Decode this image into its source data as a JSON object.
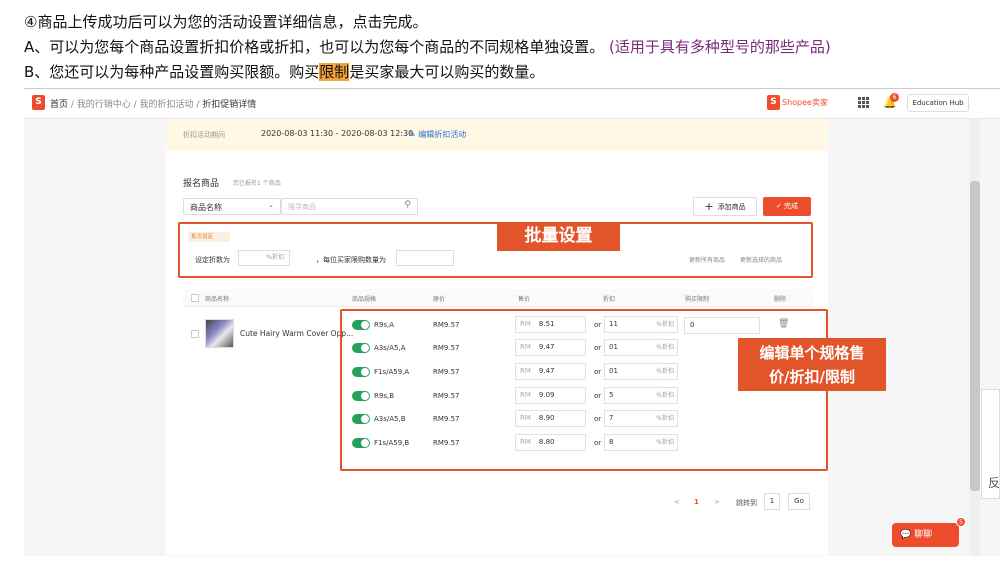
{
  "instructions": {
    "line1": "④商品上传成功后可以为您的活动设置详细信息，点击完成。",
    "line2": "A、可以为您每个商品设置折扣价格或折扣，也可以为您每个商品的不同规格单独设置。",
    "line2_note": "(适用于具有多种型号的那些产品)",
    "line3_a": "B、您还可以为每种产品设置购买限额。购买",
    "line3_hl": "限制",
    "line3_b": "是买家最大可以购买的数量。"
  },
  "header": {
    "logo_letter": "S",
    "breadcrumb_home": "首页",
    "breadcrumb_rest": " / 我的行销中心 / 我的折扣活动 / ",
    "breadcrumb_current": "折扣促销详情",
    "brand": "Shopee卖家",
    "notif_count": "6",
    "edu_hub": "Education Hub"
  },
  "period": {
    "label": "折扣活动期间",
    "value": "2020-08-03 11:30 - 2020-08-03 12:30",
    "edit": "编辑折扣活动"
  },
  "products": {
    "title": "报名商品",
    "subtitle": "您已报名1 个商品",
    "filter_select": "商品名称",
    "search_placeholder": "搜寻商品",
    "add_button": "添加商品",
    "done_button": "完成"
  },
  "batch": {
    "tag": "批次设定",
    "discount_label": "设定折数为",
    "discount_suffix": "%折扣",
    "limit_label": "，每位买家限购数量为",
    "update_all": "更新所有商品",
    "update_selected": "更新选择的商品",
    "callout": "批量设置"
  },
  "table": {
    "headers": [
      "商品名称",
      "商品规格",
      "原价",
      "售价",
      "折扣",
      "购买限制",
      "删除"
    ],
    "product_name": "Cute Hairy Warm Cover Opp...",
    "limit_value": "0",
    "currency": "RM",
    "or_label": "or",
    "pct_label": "%折扣",
    "rows": [
      {
        "spec": "R9s,A",
        "orig": "RM9.57",
        "price": "8.51",
        "discount": "11"
      },
      {
        "spec": "A3s/A5,A",
        "orig": "RM9.57",
        "price": "9.47",
        "discount": "01"
      },
      {
        "spec": "F1s/A59,A",
        "orig": "RM9.57",
        "price": "9.47",
        "discount": "01"
      },
      {
        "spec": "R9s,B",
        "orig": "RM9.57",
        "price": "9.09",
        "discount": "5"
      },
      {
        "spec": "A3s/A5,B",
        "orig": "RM9.57",
        "price": "8.90",
        "discount": "7"
      },
      {
        "spec": "F1s/A59,B",
        "orig": "RM9.57",
        "price": "8.80",
        "discount": "8"
      }
    ],
    "callout_line1": "编辑单个规格售",
    "callout_line2": "价/折扣/限制"
  },
  "pager": {
    "prev": "<",
    "page": "1",
    "next": ">",
    "goto_label": "跳转到",
    "goto_value": "1",
    "go": "Go"
  },
  "chat": {
    "label": "聊聊",
    "badge": "5"
  },
  "side_glyph": "反",
  "colors": {
    "brand": "#ee4d2d",
    "callout": "#e2552a",
    "toggle": "#26a05a",
    "highlight": "#f3a33a",
    "note": "#7a2a7a"
  }
}
